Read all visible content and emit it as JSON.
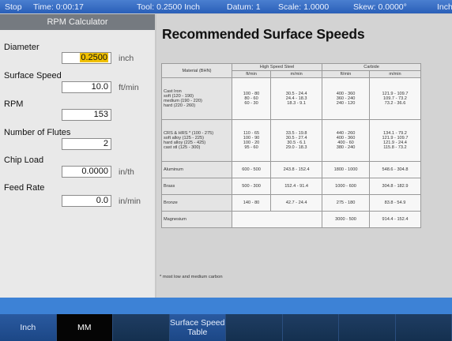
{
  "status": {
    "mode": "Stop",
    "time": "Time: 0:00:17",
    "tool": "Tool: 0.2500 Inch",
    "datum": "Datum: 1",
    "scale": "Scale: 1.0000",
    "skew": "Skew: 0.0000°",
    "units": "Inch"
  },
  "calculator": {
    "title": "RPM Calculator",
    "diameter": {
      "label": "Diameter",
      "value": "0.2500",
      "unit": "inch"
    },
    "surface_speed": {
      "label": "Surface Speed",
      "value": "10.0",
      "unit": "ft/min"
    },
    "rpm": {
      "label": "RPM",
      "value": "153"
    },
    "flutes": {
      "label": "Number of Flutes",
      "value": "2"
    },
    "chip_load": {
      "label": "Chip Load",
      "value": "0.0000",
      "unit": "in/th"
    },
    "feed_rate": {
      "label": "Feed Rate",
      "value": "0.0",
      "unit": "in/min"
    }
  },
  "page_title": "Recommended Surface Speeds",
  "table": {
    "material_header": "Material (BHN)",
    "hss_header": "High Speed Steel",
    "carbide_header": "Carbide",
    "ftmin": "ft/min",
    "mmin": "m/min",
    "rows": [
      {
        "material": [
          "Cast Iron",
          "soft (120 - 190)",
          "medium (190 - 220)",
          "hard (220 - 260)"
        ],
        "hss_ft": [
          "",
          "100 - 80",
          "80 - 60",
          "60 - 30"
        ],
        "hss_m": [
          "",
          "30.5 - 24.4",
          "24.4 - 18.3",
          "18.3 - 9.1"
        ],
        "carb_ft": [
          "",
          "400 - 360",
          "360 - 240",
          "240 - 120"
        ],
        "carb_m": [
          "",
          "121.9 - 109.7",
          "109.7 - 73.2",
          "73.2 - 36.6"
        ]
      },
      {
        "material": [
          "CRS & HRS * (100 - 275)",
          "soft alloy (125 - 225)",
          "hard alloy (225 - 425)",
          "cast stl (125 - 300)"
        ],
        "hss_ft": [
          "110 - 65",
          "100 - 90",
          "100 - 20",
          "95 - 60"
        ],
        "hss_m": [
          "33.5 - 19.8",
          "30.5 - 27.4",
          "30.5 - 6.1",
          "29.0 - 18.3"
        ],
        "carb_ft": [
          "440 - 260",
          "400 - 360",
          "400 - 60",
          "380 - 240"
        ],
        "carb_m": [
          "134.1 - 79.2",
          "121.9 - 109.7",
          "121.9 - 24.4",
          "115.8 - 73.2"
        ]
      },
      {
        "material": [
          "Aluminum"
        ],
        "hss_ft": [
          "600 - 500"
        ],
        "hss_m": [
          "243.8 - 152.4"
        ],
        "carb_ft": [
          "1800 - 1000"
        ],
        "carb_m": [
          "548.6 - 304.8"
        ]
      },
      {
        "material": [
          "Brass"
        ],
        "hss_ft": [
          "500 - 300"
        ],
        "hss_m": [
          "152.4 - 91.4"
        ],
        "carb_ft": [
          "1000 - 600"
        ],
        "carb_m": [
          "304.8 - 182.9"
        ]
      },
      {
        "material": [
          "Bronze"
        ],
        "hss_ft": [
          "140 - 80"
        ],
        "hss_m": [
          "42.7 - 24.4"
        ],
        "carb_ft": [
          "275 - 180"
        ],
        "carb_m": [
          "83.8 - 54.9"
        ]
      },
      {
        "material": [
          "Magnesium"
        ],
        "hss_ft": [
          ""
        ],
        "hss_m": [
          ""
        ],
        "carb_ft": [
          "3000 - 500"
        ],
        "carb_m": [
          "914.4 - 152.4"
        ]
      }
    ]
  },
  "footnote": "* most low and medium carbon",
  "softkeys": [
    {
      "label": "Inch"
    },
    {
      "label": "MM"
    },
    {
      "label": ""
    },
    {
      "label": "Surface Speed Table"
    },
    {
      "label": ""
    },
    {
      "label": ""
    },
    {
      "label": ""
    },
    {
      "label": ""
    }
  ],
  "colors": {
    "status_bar": "#3b6fc6",
    "softkey": "#1a365a",
    "highlight": "#f0c000"
  }
}
